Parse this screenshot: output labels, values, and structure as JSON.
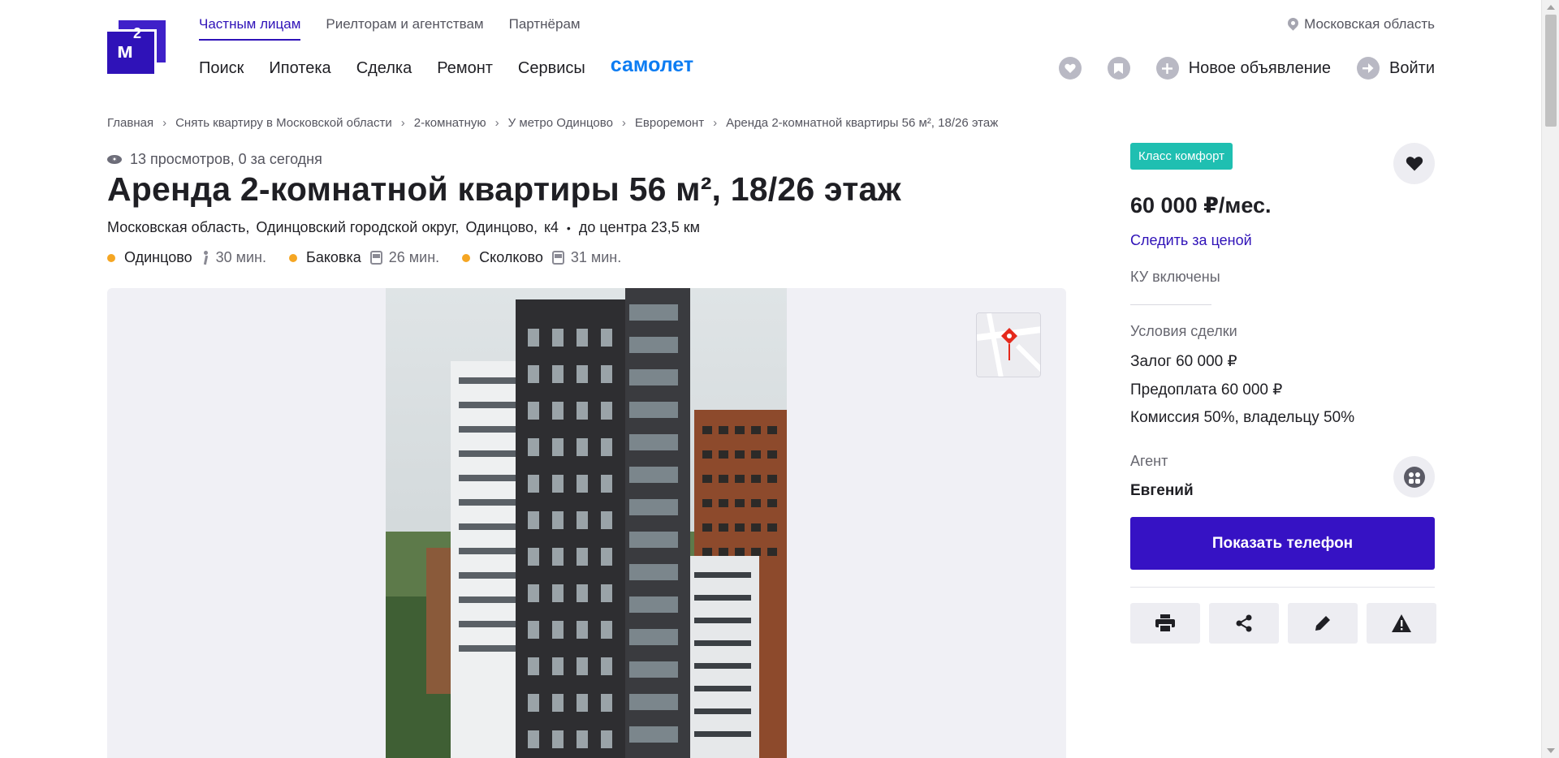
{
  "header": {
    "top_nav": [
      "Частным лицам",
      "Риелторам и агентствам",
      "Партнёрам"
    ],
    "main_nav": [
      "Поиск",
      "Ипотека",
      "Сделка",
      "Ремонт",
      "Сервисы"
    ],
    "samolet": "самолет",
    "region": "Московская область",
    "new_ad": "Новое объявление",
    "login": "Войти",
    "logo_text": "м",
    "logo_sup": "2"
  },
  "breadcrumb": [
    "Главная",
    "Снять квартиру в Московской области",
    "2-комнатную",
    "У метро Одинцово",
    "Евроремонт",
    "Аренда 2-комнатной квартиры 56 м², 18/26 этаж"
  ],
  "listing": {
    "views": "13 просмотров, 0 за сегодня",
    "title": "Аренда 2-комнатной квартиры 56 м², 18/26 этаж",
    "address_parts": [
      "Московская область,",
      "Одинцовский городской округ,",
      "Одинцово,",
      "к4"
    ],
    "distance": "до центра 23,5 км",
    "stations": [
      {
        "name": "Одинцово",
        "mode": "walk",
        "time": "30 мин."
      },
      {
        "name": "Баковка",
        "mode": "bus",
        "time": "26 мин."
      },
      {
        "name": "Сколково",
        "mode": "bus",
        "time": "31 мин."
      }
    ]
  },
  "sidebar": {
    "badge": "Класс комфорт",
    "price": "60 000 ₽/мес.",
    "watch_price": "Следить за ценой",
    "utilities": "КУ включены",
    "conditions_title": "Условия сделки",
    "conditions": [
      "Залог 60 000 ₽",
      "Предоплата 60 000 ₽",
      "Комиссия 50%, владельцу 50%"
    ],
    "agent_label": "Агент",
    "agent_name": "Евгений",
    "phone_button": "Показать телефон"
  },
  "colors": {
    "brand": "#2f12b8",
    "accent_blue": "#0c7cf2",
    "badge": "#1fbfb1",
    "metro_dot": "#f5a623"
  }
}
